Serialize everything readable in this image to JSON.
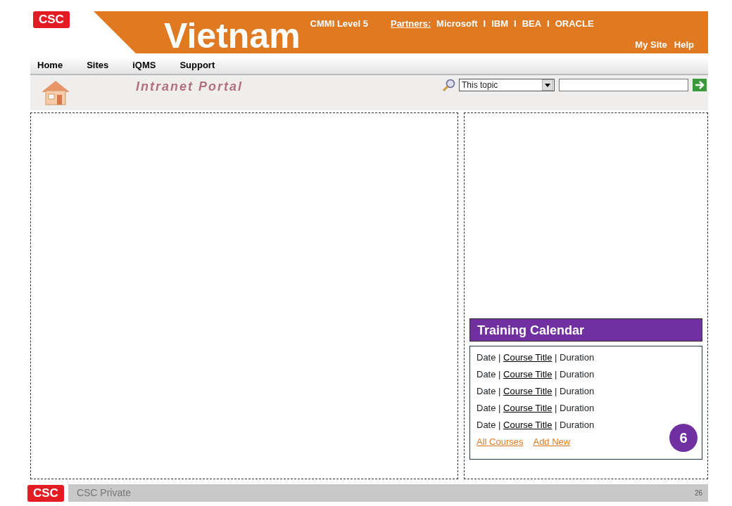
{
  "header": {
    "logo": "CSC",
    "title": "Vietnam",
    "certification": "CMMI Level 5",
    "partners_label": "Partners:",
    "partners": [
      {
        "name": "Microsoft",
        "separator": "I"
      },
      {
        "name": "IBM",
        "separator": "I"
      },
      {
        "name": "BEA",
        "separator": "I"
      },
      {
        "name": "ORACLE"
      }
    ],
    "links": [
      "My Site",
      "Help"
    ]
  },
  "nav": {
    "items": [
      "Home",
      "Sites",
      "iQMS",
      "Support"
    ]
  },
  "portal_bar": {
    "title": "Intranet Portal",
    "search": {
      "scope": "This topic"
    }
  },
  "training_calendar": {
    "title": "Training Calendar",
    "entries": [
      {
        "date": "Date",
        "separator_1": "|",
        "course": "Course Title",
        "separator_2": "|",
        "duration": "Duration"
      },
      {
        "date": "Date",
        "separator_1": "|",
        "course": "Course Title",
        "separator_2": "|",
        "duration": "Duration"
      },
      {
        "date": "Date",
        "separator_1": "|",
        "course": "Course Title",
        "separator_2": "|",
        "duration": "Duration"
      },
      {
        "date": "Date",
        "separator_1": "|",
        "course": "Course Title",
        "separator_2": "|",
        "duration": "Duration"
      },
      {
        "date": "Date",
        "separator_1": "|",
        "course": "Course Title",
        "separator_2": "|",
        "duration": "Duration"
      }
    ],
    "links": [
      "All Courses",
      "Add New"
    ],
    "badge": "6"
  },
  "footer": {
    "logo": "CSC",
    "label": "CSC Private",
    "page": "26"
  }
}
